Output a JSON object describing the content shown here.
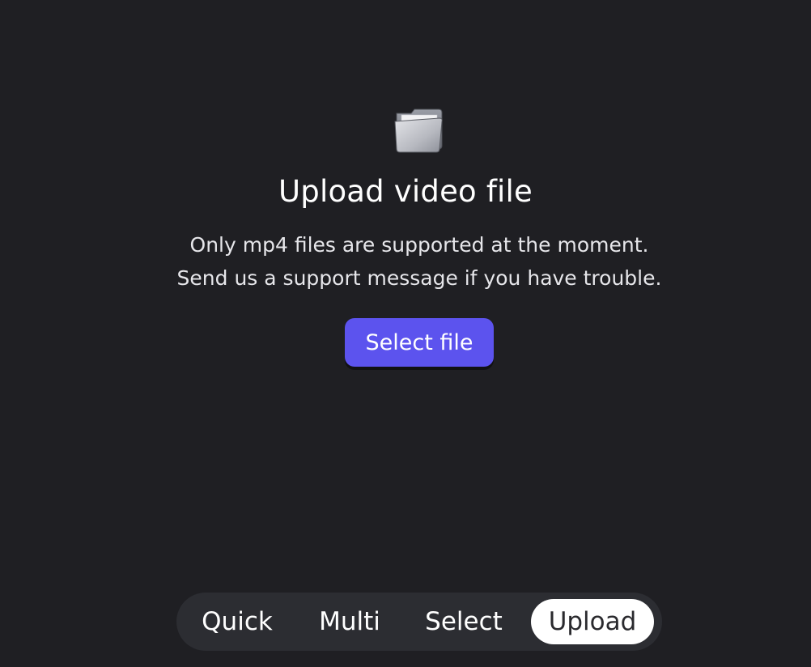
{
  "upload": {
    "title": "Upload video file",
    "description_lines": [
      "Only mp4 files are supported at the moment.",
      "Send us a support message if you have trouble."
    ],
    "select_button_label": "Select file"
  },
  "icons": {
    "folder": "folder-icon"
  },
  "tabs": [
    {
      "label": "Quick",
      "active": false
    },
    {
      "label": "Multi",
      "active": false
    },
    {
      "label": "Select",
      "active": false
    },
    {
      "label": "Upload",
      "active": true
    }
  ],
  "colors": {
    "background": "#1f1f23",
    "accent": "#5c53ee",
    "tabbar": "#2c2d32",
    "active_tab": "#ffffff"
  }
}
